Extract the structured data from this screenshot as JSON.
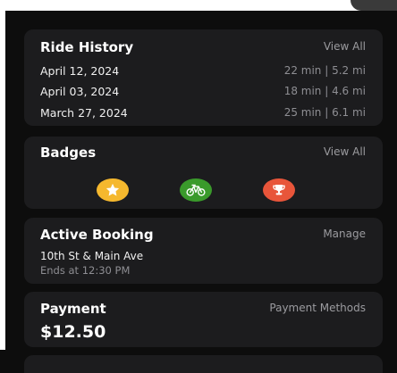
{
  "ride_history": {
    "title": "Ride History",
    "action": "View All",
    "rides": [
      {
        "date": "April 12, 2024",
        "stats": "22 min | 5.2 mi"
      },
      {
        "date": "April 03, 2024",
        "stats": "18 min | 4.6 mi"
      },
      {
        "date": "March 27, 2024",
        "stats": "25 min | 6.1 mi"
      }
    ]
  },
  "badges": {
    "title": "Badges",
    "action": "View All",
    "items": [
      {
        "icon": "star-icon",
        "color": "#f5b82e"
      },
      {
        "icon": "bicycle-icon",
        "color": "#3a9a2b"
      },
      {
        "icon": "trophy-icon",
        "color": "#e8553a"
      }
    ]
  },
  "active_booking": {
    "title": "Active Booking",
    "action": "Manage",
    "location": "10th St & Main Ave",
    "ends": "Ends at 12:30 PM"
  },
  "payment": {
    "title": "Payment",
    "action": "Payment Methods",
    "amount": "$12.50"
  }
}
